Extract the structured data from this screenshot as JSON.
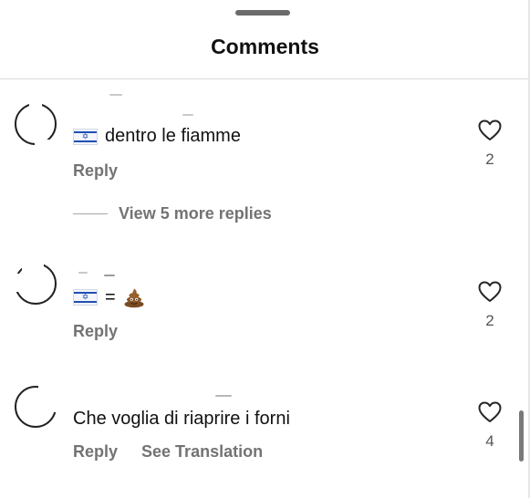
{
  "sheet": {
    "title": "Comments"
  },
  "comments": [
    {
      "text": "dentro le fiamme",
      "prefix_flag": "israel-flag-icon",
      "reply_label": "Reply",
      "view_replies_label": "View 5 more replies",
      "like_count": "2"
    },
    {
      "text_equals": "=",
      "prefix_flag": "israel-flag-icon",
      "suffix_emoji": "pile-of-poo-icon",
      "reply_label": "Reply",
      "like_count": "2"
    },
    {
      "text": "Che voglia di riaprire i forni",
      "reply_label": "Reply",
      "translation_label": "See Translation",
      "like_count": "4"
    }
  ],
  "icons": {
    "heart": "heart-icon",
    "flag": "israel-flag-icon",
    "emoji": "pile-of-poo-icon"
  },
  "colors": {
    "secondary_text": "#737373",
    "flag_blue": "#1f4fb3",
    "divider": "#dbdbdb"
  }
}
